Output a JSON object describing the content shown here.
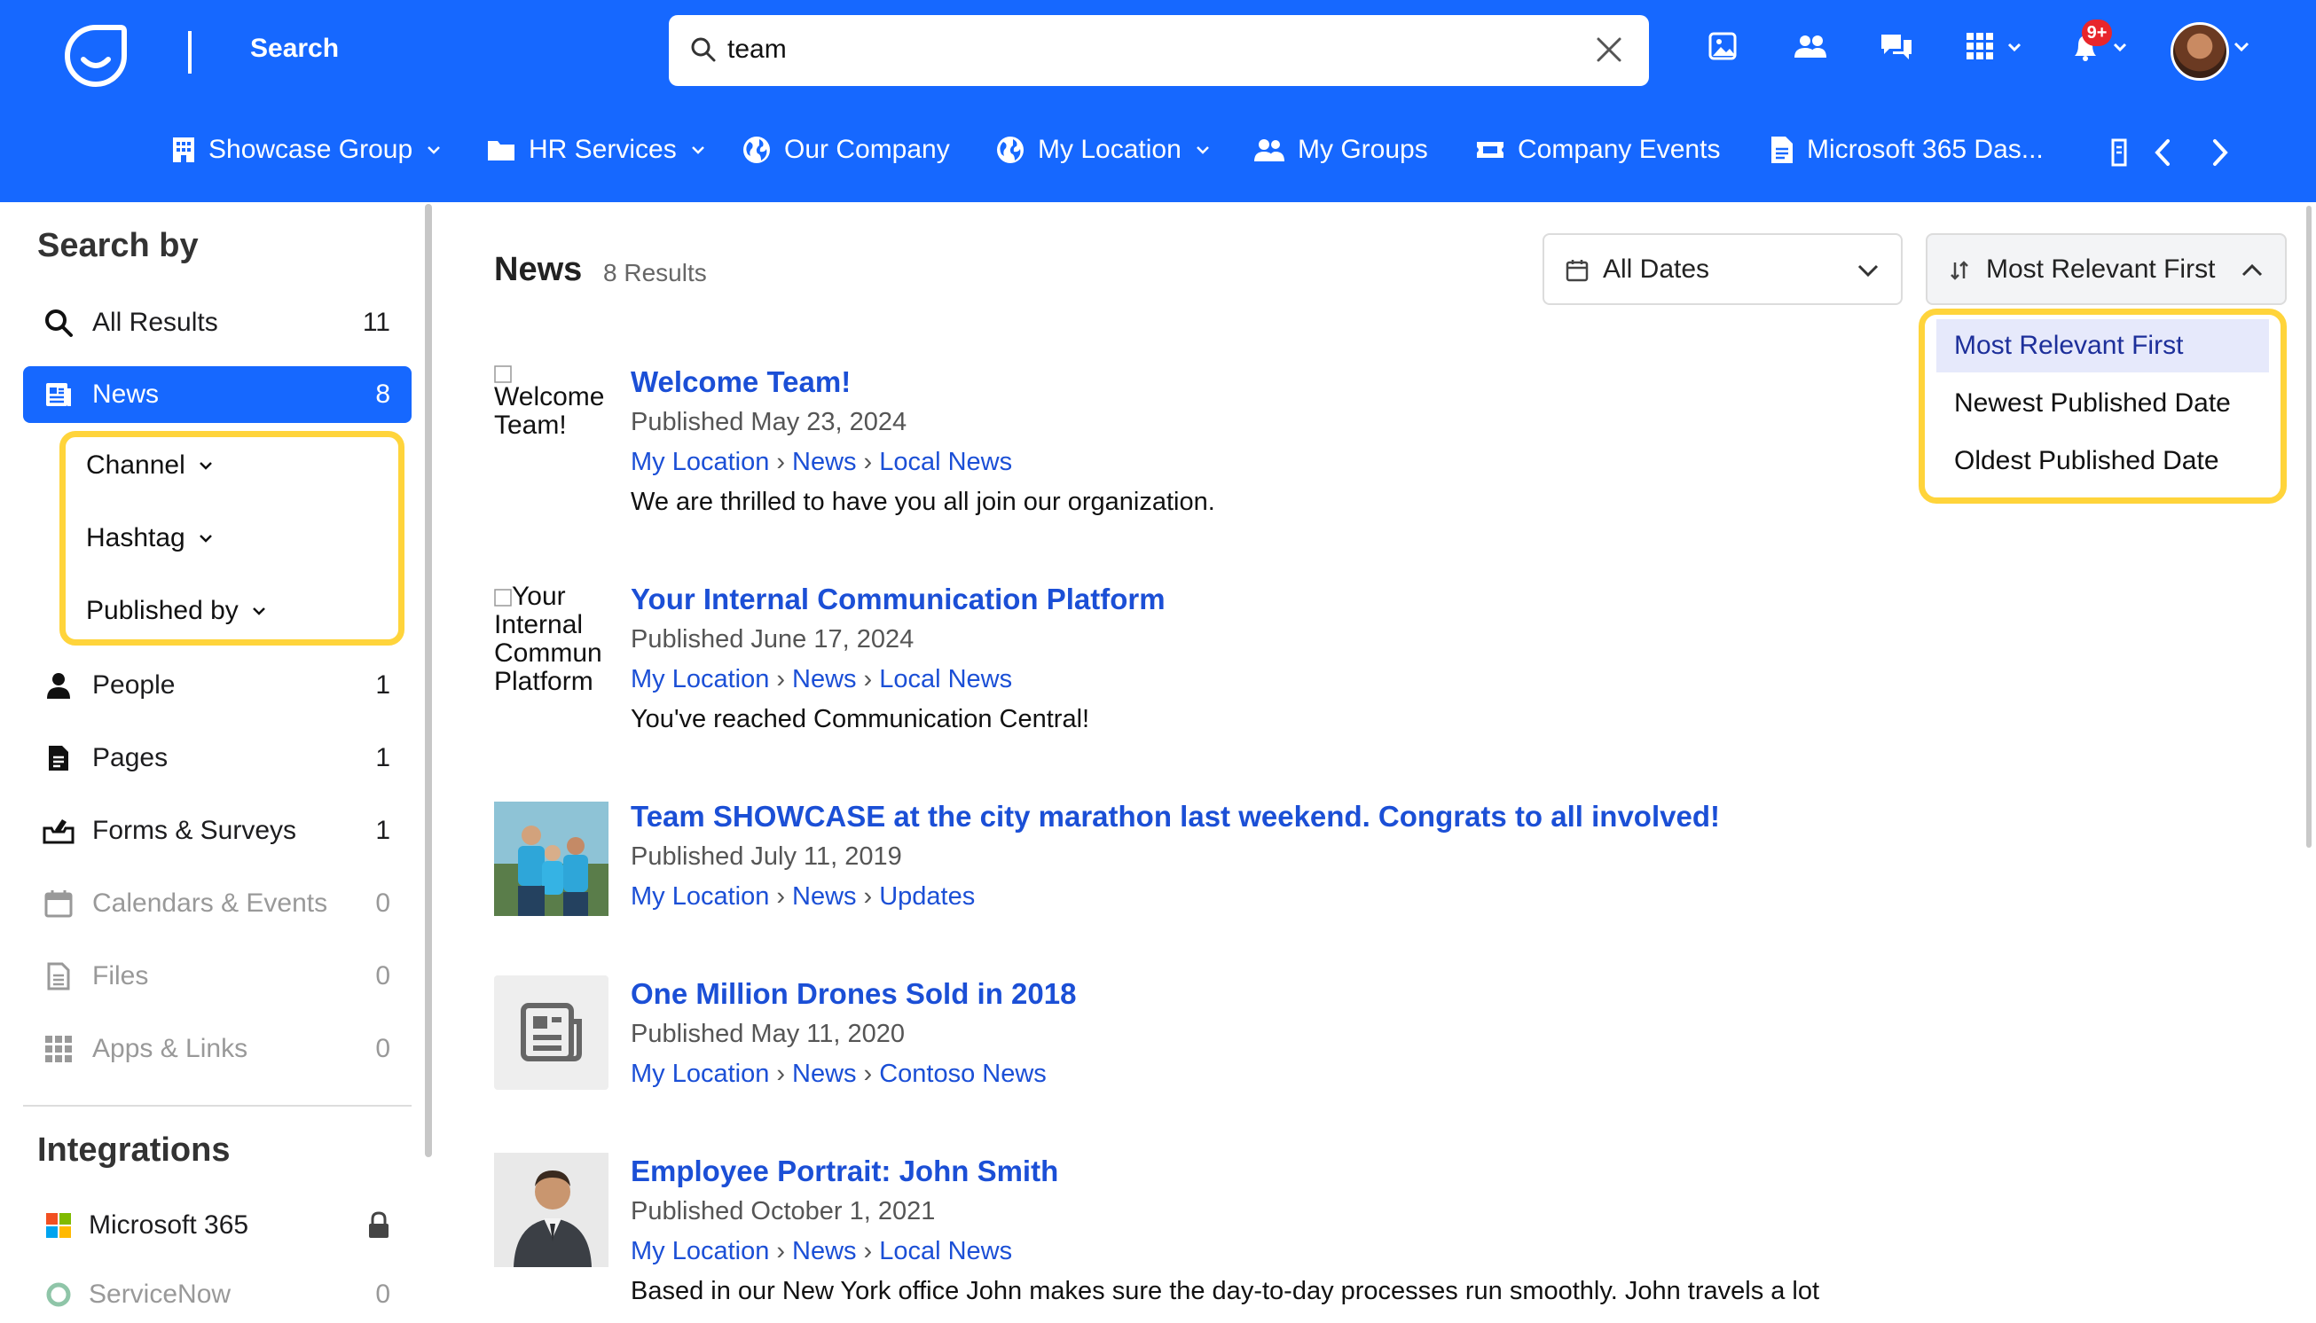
{
  "header": {
    "title": "Search",
    "search": {
      "value": "team",
      "placeholder": "Search"
    },
    "notification_badge": "9+",
    "icons": [
      "image-icon",
      "people-icon",
      "chat-icon",
      "apps-grid-icon",
      "bell-icon",
      "avatar"
    ]
  },
  "nav": {
    "items": [
      {
        "label": "Showcase Group",
        "icon": "building-icon",
        "dropdown": true
      },
      {
        "label": "HR Services",
        "icon": "folder-icon",
        "dropdown": true
      },
      {
        "label": "Our Company",
        "icon": "globe-icon",
        "dropdown": false
      },
      {
        "label": "My Location",
        "icon": "globe-icon",
        "dropdown": true
      },
      {
        "label": "My Groups",
        "icon": "people-icon",
        "dropdown": false
      },
      {
        "label": "Company Events",
        "icon": "ticket-icon",
        "dropdown": false
      },
      {
        "label": "Microsoft 365 Das...",
        "icon": "document-icon",
        "dropdown": false
      }
    ]
  },
  "sidebar": {
    "title": "Search by",
    "items": [
      {
        "label": "All Results",
        "count": "11",
        "icon": "search-icon"
      },
      {
        "label": "News",
        "count": "8",
        "icon": "news-icon"
      },
      {
        "label": "People",
        "count": "1",
        "icon": "person-icon"
      },
      {
        "label": "Pages",
        "count": "1",
        "icon": "page-icon"
      },
      {
        "label": "Forms & Surveys",
        "count": "1",
        "icon": "form-icon"
      },
      {
        "label": "Calendars & Events",
        "count": "0",
        "icon": "calendar-icon"
      },
      {
        "label": "Files",
        "count": "0",
        "icon": "file-icon"
      },
      {
        "label": "Apps & Links",
        "count": "0",
        "icon": "apps-grid-icon"
      }
    ],
    "filters": [
      "Channel",
      "Hashtag",
      "Published by"
    ],
    "integrations_title": "Integrations",
    "integrations": [
      {
        "label": "Microsoft 365",
        "icon": "microsoft-icon",
        "trailing": "lock-icon"
      },
      {
        "label": "ServiceNow",
        "count": "0",
        "icon": "servicenow-icon"
      }
    ]
  },
  "main": {
    "title": "News",
    "count": "8 Results",
    "date_filter": "All Dates",
    "sort": {
      "selected": "Most Relevant First",
      "options": [
        "Most Relevant First",
        "Newest Published Date",
        "Oldest Published Date"
      ]
    },
    "results": [
      {
        "title": "Welcome Team!",
        "date": "Published May 23, 2024",
        "crumbs": [
          "My Location",
          "News",
          "Local News"
        ],
        "desc": "We are thrilled to have you all join our organization.",
        "thumb_alt": "Welcome Team!"
      },
      {
        "title": "Your Internal Communication Platform",
        "date": "Published June 17, 2024",
        "crumbs": [
          "My Location",
          "News",
          "Local News"
        ],
        "desc": "You've reached Communication Central!",
        "thumb_alt": "Your Internal Commun Platform"
      },
      {
        "title": "Team SHOWCASE at the city marathon last weekend. Congrats to all involved!",
        "date": "Published July 11, 2019",
        "crumbs": [
          "My Location",
          "News",
          "Updates"
        ],
        "desc": ""
      },
      {
        "title": "One Million Drones Sold in 2018",
        "date": "Published May 11, 2020",
        "crumbs": [
          "My Location",
          "News",
          "Contoso News"
        ],
        "desc": ""
      },
      {
        "title": "Employee Portrait: John Smith",
        "date": "Published October 1, 2021",
        "crumbs": [
          "My Location",
          "News",
          "Local News"
        ],
        "desc": "Based in our New York office John makes sure the day-to-day processes run smoothly. John travels a lot"
      }
    ]
  },
  "colors": {
    "brand": "#1668ff",
    "link": "#1b4fd6",
    "highlight": "#ffd43b",
    "selected_option_bg": "#e6e9fb"
  }
}
